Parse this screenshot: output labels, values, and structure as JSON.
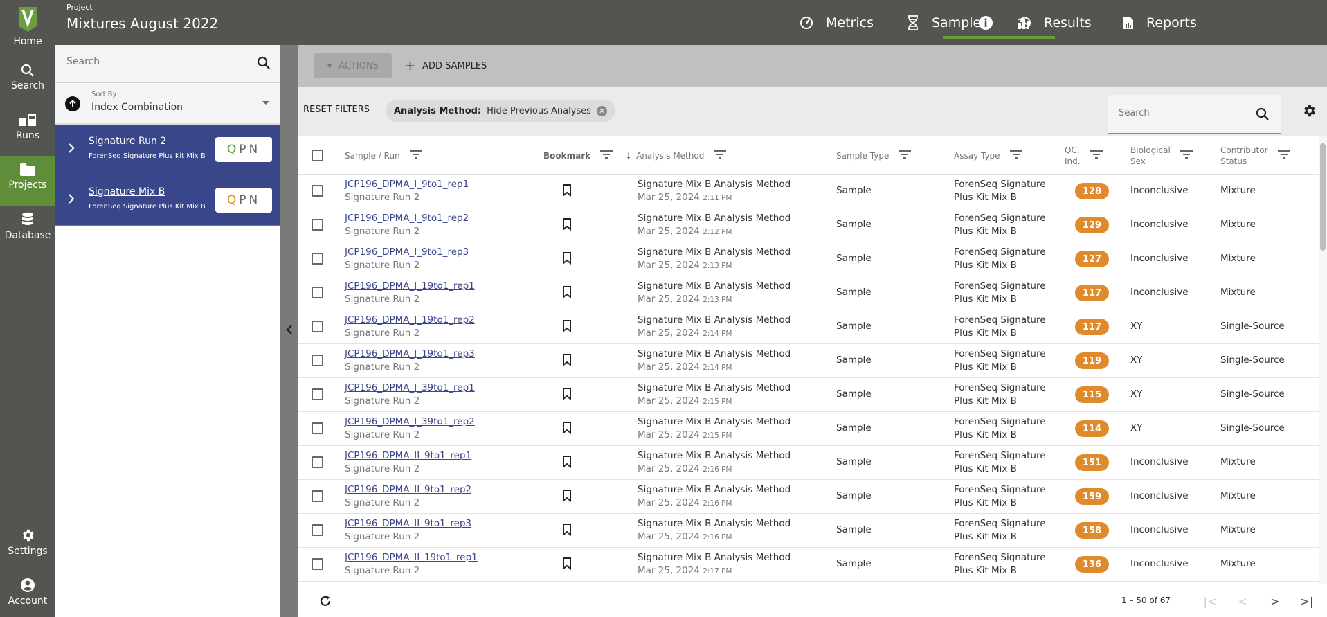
{
  "rail": {
    "items": [
      {
        "label": "Home",
        "icon": "app-logo-icon"
      },
      {
        "label": "Search",
        "icon": "search-icon"
      },
      {
        "label": "Runs",
        "icon": "runs-icon"
      },
      {
        "label": "Projects",
        "icon": "folder-icon",
        "active": true
      },
      {
        "label": "Database",
        "icon": "database-icon"
      },
      {
        "label": "Settings",
        "icon": "gear-icon"
      },
      {
        "label": "Account",
        "icon": "account-icon"
      }
    ]
  },
  "header": {
    "project_label": "Project",
    "project_title": "Mixtures August 2022",
    "tabs": [
      {
        "label": "Metrics",
        "icon": "gauge-icon"
      },
      {
        "label": "Samples",
        "icon": "dna-icon",
        "active": true
      },
      {
        "label": "Results",
        "icon": "bar-chart-icon"
      },
      {
        "label": "Reports",
        "icon": "report-icon"
      }
    ],
    "info_icon": "info-icon",
    "history_icon": "history-icon"
  },
  "left_panel": {
    "search_placeholder": "Search",
    "sort": {
      "caption": "Sort By",
      "value": "Index Combination",
      "direction": "ascending"
    },
    "runs": [
      {
        "name": "Signature Run 2",
        "kit": "ForenSeq Signature Plus Kit Mix B",
        "qpn": {
          "q": "Q",
          "p": "P",
          "n": "N",
          "q_status": "pass"
        }
      },
      {
        "name": "Signature Mix B",
        "kit": "ForenSeq Signature Plus Kit Mix B",
        "qpn": {
          "q": "Q",
          "p": "P",
          "n": "N",
          "q_status": "warning"
        }
      }
    ]
  },
  "toolbar": {
    "actions_label": "ACTIONS",
    "add_samples_label": "ADD SAMPLES"
  },
  "filters": {
    "reset_label": "RESET FILTERS",
    "chips": [
      {
        "key": "Analysis Method:",
        "value": "Hide Previous Analyses"
      }
    ],
    "search_placeholder": "Search"
  },
  "table": {
    "columns": {
      "sample_run": "Sample / Run",
      "bookmark": "Bookmark",
      "analysis_method": "Analysis Method",
      "sample_type": "Sample Type",
      "assay_type": "Assay Type",
      "qc_ind_1": "QC.",
      "qc_ind_2": "Ind.",
      "bio_sex_1": "Biological",
      "bio_sex_2": "Sex",
      "contrib_1": "Contributor",
      "contrib_2": "Status"
    },
    "sort_column": "Analysis Method",
    "sort_direction": "descending",
    "rows": [
      {
        "sample": "JCP196_DPMA_I_9to1_rep1",
        "run": "Signature Run 2",
        "method": "Signature Mix B Analysis Method",
        "date": "Mar 25, 2024",
        "time": "2:11 PM",
        "type": "Sample",
        "assay1": "ForenSeq Signature",
        "assay2": "Plus Kit Mix B",
        "qc": "128",
        "sex": "Inconclusive",
        "status": "Mixture"
      },
      {
        "sample": "JCP196_DPMA_I_9to1_rep2",
        "run": "Signature Run 2",
        "method": "Signature Mix B Analysis Method",
        "date": "Mar 25, 2024",
        "time": "2:12 PM",
        "type": "Sample",
        "assay1": "ForenSeq Signature",
        "assay2": "Plus Kit Mix B",
        "qc": "129",
        "sex": "Inconclusive",
        "status": "Mixture"
      },
      {
        "sample": "JCP196_DPMA_I_9to1_rep3",
        "run": "Signature Run 2",
        "method": "Signature Mix B Analysis Method",
        "date": "Mar 25, 2024",
        "time": "2:13 PM",
        "type": "Sample",
        "assay1": "ForenSeq Signature",
        "assay2": "Plus Kit Mix B",
        "qc": "127",
        "sex": "Inconclusive",
        "status": "Mixture"
      },
      {
        "sample": "JCP196_DPMA_I_19to1_rep1",
        "run": "Signature Run 2",
        "method": "Signature Mix B Analysis Method",
        "date": "Mar 25, 2024",
        "time": "2:13 PM",
        "type": "Sample",
        "assay1": "ForenSeq Signature",
        "assay2": "Plus Kit Mix B",
        "qc": "117",
        "sex": "Inconclusive",
        "status": "Mixture"
      },
      {
        "sample": "JCP196_DPMA_I_19to1_rep2",
        "run": "Signature Run 2",
        "method": "Signature Mix B Analysis Method",
        "date": "Mar 25, 2024",
        "time": "2:14 PM",
        "type": "Sample",
        "assay1": "ForenSeq Signature",
        "assay2": "Plus Kit Mix B",
        "qc": "117",
        "sex": "XY",
        "status": "Single-Source"
      },
      {
        "sample": "JCP196_DPMA_I_19to1_rep3",
        "run": "Signature Run 2",
        "method": "Signature Mix B Analysis Method",
        "date": "Mar 25, 2024",
        "time": "2:14 PM",
        "type": "Sample",
        "assay1": "ForenSeq Signature",
        "assay2": "Plus Kit Mix B",
        "qc": "119",
        "sex": "XY",
        "status": "Single-Source"
      },
      {
        "sample": "JCP196_DPMA_I_39to1_rep1",
        "run": "Signature Run 2",
        "method": "Signature Mix B Analysis Method",
        "date": "Mar 25, 2024",
        "time": "2:15 PM",
        "type": "Sample",
        "assay1": "ForenSeq Signature",
        "assay2": "Plus Kit Mix B",
        "qc": "115",
        "sex": "XY",
        "status": "Single-Source"
      },
      {
        "sample": "JCP196_DPMA_I_39to1_rep2",
        "run": "Signature Run 2",
        "method": "Signature Mix B Analysis Method",
        "date": "Mar 25, 2024",
        "time": "2:15 PM",
        "type": "Sample",
        "assay1": "ForenSeq Signature",
        "assay2": "Plus Kit Mix B",
        "qc": "114",
        "sex": "XY",
        "status": "Single-Source"
      },
      {
        "sample": "JCP196_DPMA_II_9to1_rep1",
        "run": "Signature Run 2",
        "method": "Signature Mix B Analysis Method",
        "date": "Mar 25, 2024",
        "time": "2:16 PM",
        "type": "Sample",
        "assay1": "ForenSeq Signature",
        "assay2": "Plus Kit Mix B",
        "qc": "151",
        "sex": "Inconclusive",
        "status": "Mixture"
      },
      {
        "sample": "JCP196_DPMA_II_9to1_rep2",
        "run": "Signature Run 2",
        "method": "Signature Mix B Analysis Method",
        "date": "Mar 25, 2024",
        "time": "2:16 PM",
        "type": "Sample",
        "assay1": "ForenSeq Signature",
        "assay2": "Plus Kit Mix B",
        "qc": "159",
        "sex": "Inconclusive",
        "status": "Mixture"
      },
      {
        "sample": "JCP196_DPMA_II_9to1_rep3",
        "run": "Signature Run 2",
        "method": "Signature Mix B Analysis Method",
        "date": "Mar 25, 2024",
        "time": "2:16 PM",
        "type": "Sample",
        "assay1": "ForenSeq Signature",
        "assay2": "Plus Kit Mix B",
        "qc": "158",
        "sex": "Inconclusive",
        "status": "Mixture"
      },
      {
        "sample": "JCP196_DPMA_II_19to1_rep1",
        "run": "Signature Run 2",
        "method": "Signature Mix B Analysis Method",
        "date": "Mar 25, 2024",
        "time": "2:17 PM",
        "type": "Sample",
        "assay1": "ForenSeq Signature",
        "assay2": "Plus Kit Mix B",
        "qc": "136",
        "sex": "Inconclusive",
        "status": "Mixture"
      }
    ]
  },
  "pagination": {
    "range_text": "1 – 50 of 67"
  },
  "colors": {
    "accent_green": "#6a9e3f",
    "run_blue": "#3a468a",
    "qc_orange": "#df8a2c",
    "rail_bg": "#535551"
  }
}
